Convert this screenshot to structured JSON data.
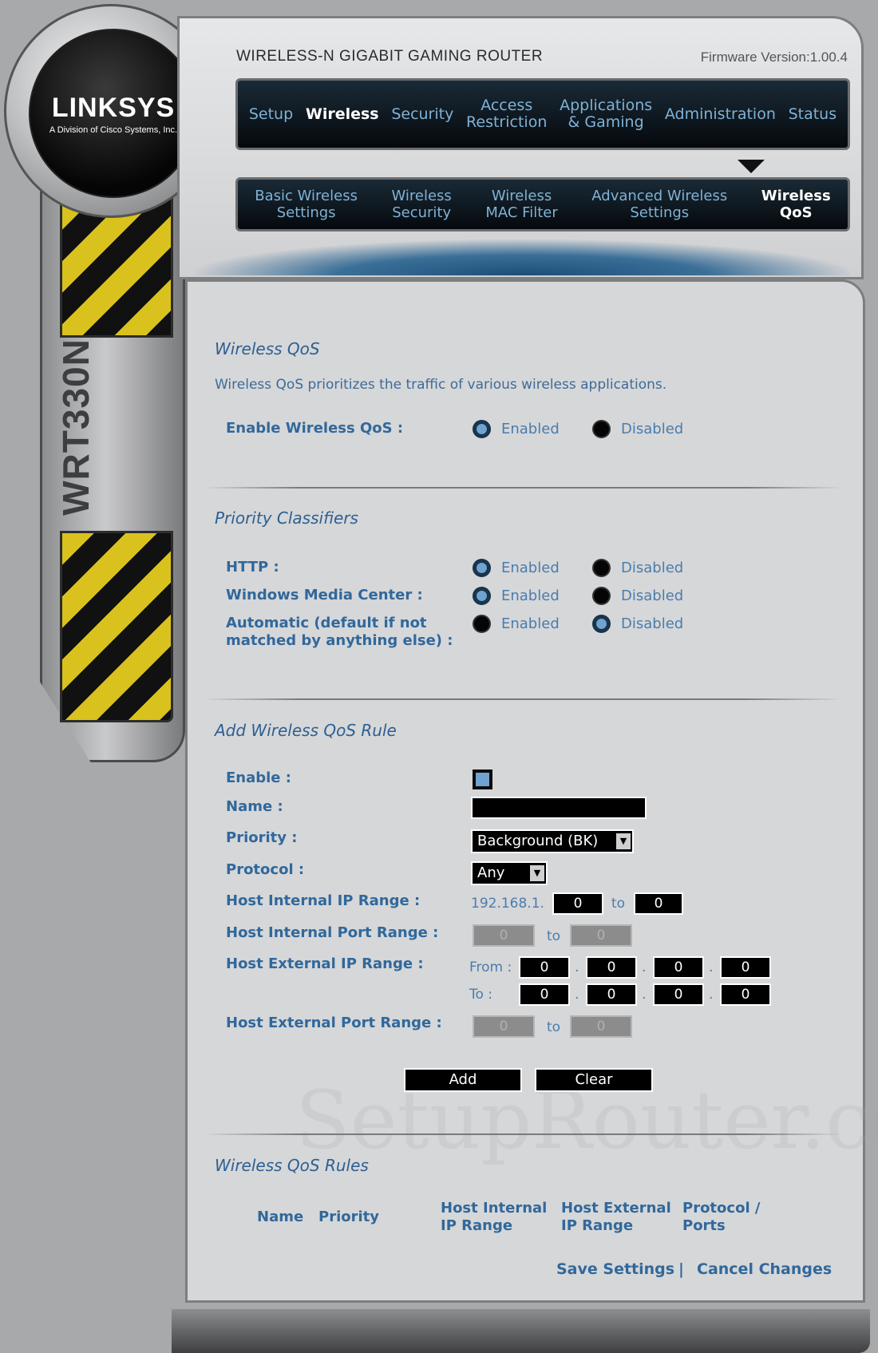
{
  "brand": {
    "logo": "LINKSYS",
    "logo_sub": "A Division of Cisco Systems, Inc.",
    "model": "WRT330N",
    "product_name": "WIRELESS-N  GIGABIT  GAMING  ROUTER",
    "firmware": "Firmware Version:1.00.4"
  },
  "nav": {
    "items": [
      {
        "label": "Setup"
      },
      {
        "label": "Wireless"
      },
      {
        "label": "Security"
      },
      {
        "label": "Access\nRestriction"
      },
      {
        "label": "Applications\n& Gaming"
      },
      {
        "label": "Administration"
      },
      {
        "label": "Status"
      }
    ],
    "active": "Wireless"
  },
  "subnav": {
    "items": [
      {
        "label": "Basic Wireless\nSettings"
      },
      {
        "label": "Wireless\nSecurity"
      },
      {
        "label": "Wireless\nMAC Filter"
      },
      {
        "label": "Advanced Wireless\nSettings"
      },
      {
        "label": "Wireless\nQoS"
      }
    ],
    "active": "Wireless\nQoS"
  },
  "qos": {
    "title": "Wireless QoS",
    "description": "Wireless QoS prioritizes the traffic of various wireless applications.",
    "enable_label": "Enable Wireless QoS :",
    "enabled_label": "Enabled",
    "disabled_label": "Disabled",
    "enable_value": "Enabled"
  },
  "classifiers": {
    "title": "Priority Classifiers",
    "rows": [
      {
        "label": "HTTP :",
        "value": "Enabled"
      },
      {
        "label": "Windows Media Center :",
        "value": "Enabled"
      },
      {
        "label": "Automatic (default if not\nmatched by anything else) :",
        "value": "Disabled"
      }
    ],
    "enabled_label": "Enabled",
    "disabled_label": "Disabled"
  },
  "add_rule": {
    "title": "Add Wireless QoS Rule",
    "enable_label": "Enable :",
    "name_label": "Name :",
    "name_value": "",
    "priority_label": "Priority :",
    "priority_value": "Background (BK)",
    "protocol_label": "Protocol :",
    "protocol_value": "Any",
    "internal_ip_label": "Host Internal IP Range :",
    "internal_ip_prefix": "192.168.1.",
    "internal_ip_from": "0",
    "internal_ip_to": "0",
    "internal_port_label": "Host Internal Port Range :",
    "internal_port_from": "0",
    "internal_port_to": "0",
    "external_ip_label": "Host External IP Range :",
    "from_label": "From :",
    "to_label": "To :",
    "range_to": "to",
    "dot": ".",
    "external_from": [
      "0",
      "0",
      "0",
      "0"
    ],
    "external_to": [
      "0",
      "0",
      "0",
      "0"
    ],
    "external_port_label": "Host External Port Range :",
    "external_port_from": "0",
    "external_port_to": "0",
    "add_button": "Add",
    "clear_button": "Clear"
  },
  "rules": {
    "title": "Wireless QoS Rules",
    "columns": [
      "Name",
      "Priority",
      "Host Internal\nIP Range",
      "Host External\nIP Range",
      "Protocol /\nPorts"
    ]
  },
  "footer": {
    "save": "Save Settings",
    "separator": "|",
    "cancel": "Cancel Changes"
  },
  "watermark": "SetupRouter.com",
  "colors": {
    "accent": "#31689b",
    "nav_text": "#7fb2d6",
    "stripe_yellow": "#d9c21d"
  }
}
